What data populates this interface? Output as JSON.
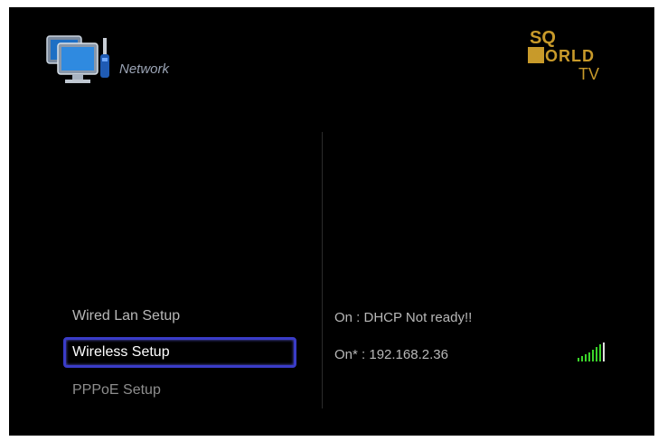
{
  "header": {
    "title": "Network",
    "brand_lines": [
      "SQ",
      "WORLD",
      "TV"
    ]
  },
  "menu": {
    "items": [
      {
        "label": "Wired Lan Setup",
        "selected": false
      },
      {
        "label": "Wireless Setup",
        "selected": true
      },
      {
        "label": "PPPoE Setup",
        "selected": false
      }
    ]
  },
  "status": {
    "wired": "On : DHCP Not ready!!",
    "wireless": "On* : 192.168.2.36",
    "signal_icon": "wifi-signal-icon",
    "signal_color": "#3bd42a"
  },
  "colors": {
    "background": "#000000",
    "selection_border": "#3a3cc8",
    "brand_gold": "#c89a2a"
  }
}
